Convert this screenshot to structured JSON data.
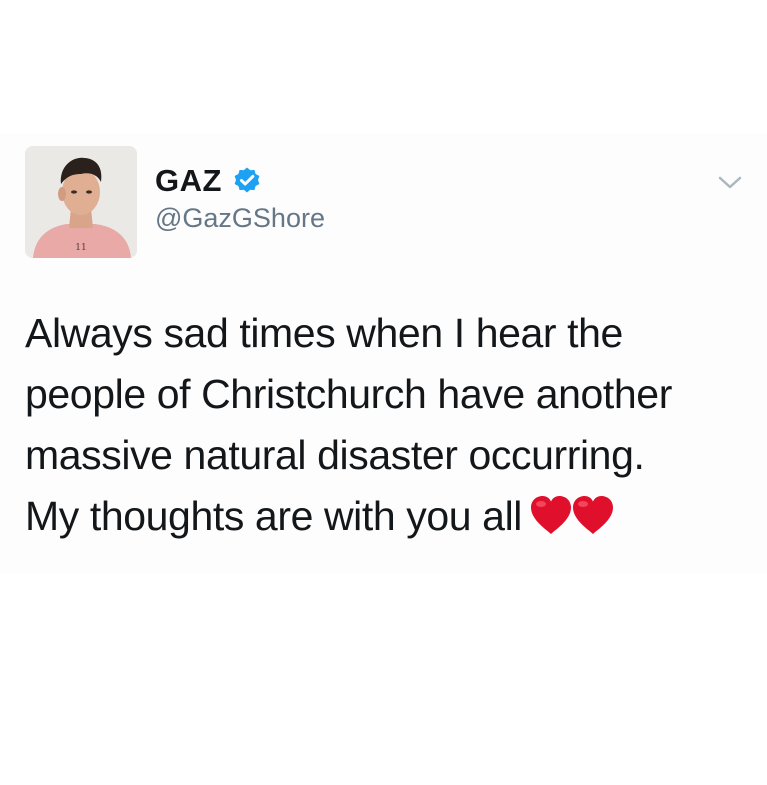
{
  "tweet": {
    "author": {
      "name": "GAZ",
      "handle": "@GazGShore",
      "verified": true,
      "avatar_icon": "profile-photo"
    },
    "text_lines": [
      "Always sad times when I hear the",
      "people of Christchurch have another",
      "massive natural disaster occurring.",
      "My thoughts are with you all"
    ],
    "emojis": [
      "red-heart",
      "red-heart"
    ],
    "menu_icon": "chevron-down-icon"
  },
  "colors": {
    "text": "#14171a",
    "handle": "#657786",
    "verified_blue": "#1da1f2",
    "heart_red": "#e0102c",
    "chevron": "#aab8c2"
  }
}
